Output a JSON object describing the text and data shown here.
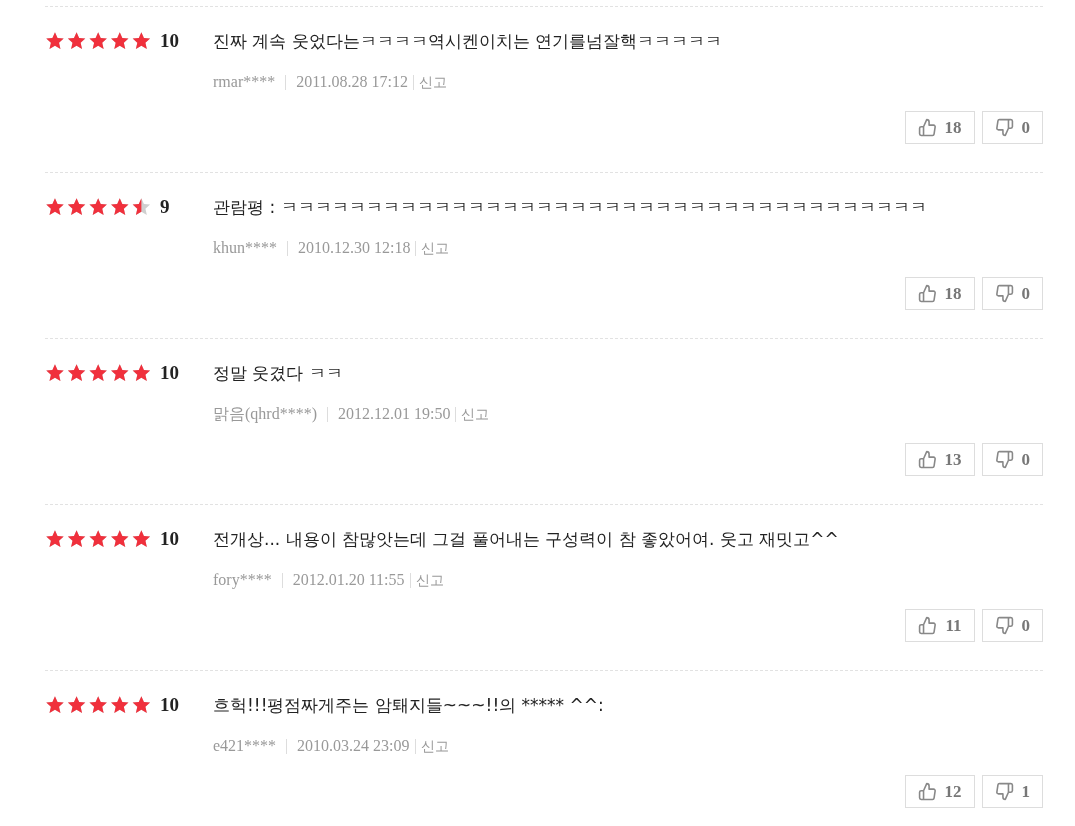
{
  "reviews": [
    {
      "stars": 5,
      "score": "10",
      "text": "진짜 계속 웃었다는ㅋㅋㅋㅋ역시켄이치는 연기를넘잘핵ㅋㅋㅋㅋㅋ",
      "author": "rmar****",
      "date": "2011.08.28 17:12",
      "report": "신고",
      "likes": "18",
      "dislikes": "0"
    },
    {
      "stars": 4.5,
      "score": "9",
      "text": "관람평 : ㅋㅋㅋㅋㅋㅋㅋㅋㅋㅋㅋㅋㅋㅋㅋㅋㅋㅋㅋㅋㅋㅋㅋㅋㅋㅋㅋㅋㅋㅋㅋㅋㅋㅋㅋㅋㅋㅋ",
      "author": "khun****",
      "date": "2010.12.30 12:18",
      "report": "신고",
      "likes": "18",
      "dislikes": "0"
    },
    {
      "stars": 5,
      "score": "10",
      "text": "정말 웃겼다 ㅋㅋ",
      "author": "맑음(qhrd****)",
      "date": "2012.12.01 19:50",
      "report": "신고",
      "likes": "13",
      "dislikes": "0"
    },
    {
      "stars": 5,
      "score": "10",
      "text": "전개상... 내용이 참많앗는데 그걸 풀어내는 구성력이 참 좋았어여. 웃고 재밋고^^",
      "author": "fory****",
      "date": "2012.01.20 11:55",
      "report": "신고",
      "likes": "11",
      "dislikes": "0"
    },
    {
      "stars": 5,
      "score": "10",
      "text": "흐헉!!!평점짜게주는 암퇘지들~~~!!의 ***** ^^:",
      "author": "e421****",
      "date": "2010.03.24 23:09",
      "report": "신고",
      "likes": "12",
      "dislikes": "1"
    }
  ]
}
